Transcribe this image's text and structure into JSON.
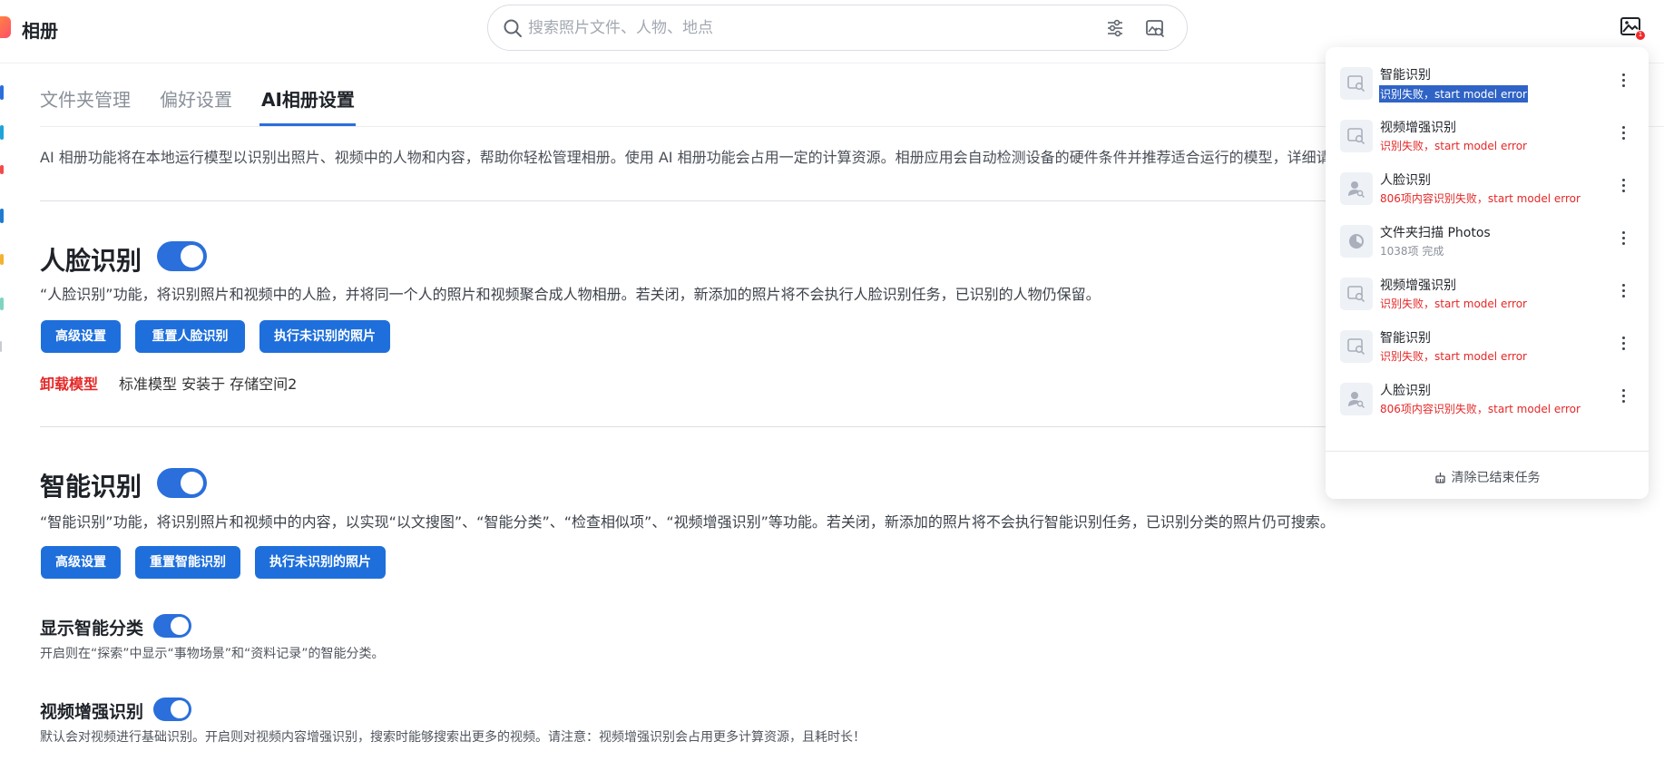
{
  "app": {
    "title": "相册",
    "logo_icon": "photos-app-icon"
  },
  "search": {
    "placeholder": "搜索照片文件、人物、地点",
    "value": "",
    "icons": [
      "search-icon",
      "filter-sliders-icon",
      "image-search-icon"
    ]
  },
  "header": {
    "task_badge": "1",
    "task_icon": "task-image-icon"
  },
  "tabs": [
    {
      "label": "文件夹管理",
      "active": false
    },
    {
      "label": "偏好设置",
      "active": false
    },
    {
      "label": "AI相册设置",
      "active": true
    }
  ],
  "intro": "AI 相册功能将在本地运行模型以识别出照片、视频中的人物和内容，帮助你轻松管理相册。使用 AI 相册功能会占用一定的计算资源。相册应用会自动检测设备的硬件条件并推荐适合运行的模型，详细请",
  "face": {
    "title": "人脸识别",
    "enabled": true,
    "desc": "“人脸识别”功能，将识别照片和视频中的人脸，并将同一个人的照片和视频聚合成人物相册。若关闭，新添加的照片将不会执行人脸识别任务，已识别的人物仍保留。",
    "buttons": {
      "advanced": "高级设置",
      "reset": "重置人脸识别",
      "run": "执行未识别的照片"
    },
    "uninstall": "卸载模型",
    "model_info": "标准模型 安装于 存储空间2"
  },
  "smart": {
    "title": "智能识别",
    "enabled": true,
    "desc": "“智能识别”功能，将识别照片和视频中的内容，以实现“以文搜图”、“智能分类”、“检查相似项”、“视频增强识别”等功能。若关闭，新添加的照片将不会执行智能识别任务，已识别分类的照片仍可搜索。",
    "buttons": {
      "advanced": "高级设置",
      "reset": "重置智能识别",
      "run": "执行未识别的照片"
    }
  },
  "show_category": {
    "title": "显示智能分类",
    "enabled": true,
    "desc": "开启则在“探索”中显示“事物场景”和“资料记录”的智能分类。"
  },
  "video_enhance": {
    "title": "视频增强识别",
    "enabled": true,
    "desc": "默认会对视频进行基础识别。开启则对视频内容增强识别，搜索时能够搜索出更多的视频。请注意：视频增强识别会占用更多计算资源，且耗时长！"
  },
  "tasks": {
    "items": [
      {
        "name": "智能识别",
        "status": "识别失败，start model error",
        "state": "error-selected",
        "icon": "image-search-icon"
      },
      {
        "name": "视频增强识别",
        "status": "识别失败，start model error",
        "state": "error",
        "icon": "image-search-icon"
      },
      {
        "name": "人脸识别",
        "status": "806项内容识别失败，start model error",
        "state": "error",
        "icon": "person-search-icon"
      },
      {
        "name": "文件夹扫描 Photos",
        "status": "1038项 完成",
        "state": "done",
        "icon": "pie-progress-icon"
      },
      {
        "name": "视频增强识别",
        "status": "识别失败，start model error",
        "state": "error",
        "icon": "image-search-icon"
      },
      {
        "name": "智能识别",
        "status": "识别失败，start model error",
        "state": "error",
        "icon": "image-search-icon"
      },
      {
        "name": "人脸识别",
        "status": "806项内容识别失败，start model error",
        "state": "error",
        "icon": "person-search-icon"
      }
    ],
    "clear_label": "清除已结束任务"
  },
  "colors": {
    "accent": "#1e6fdb",
    "error": "#e52727",
    "selection": "#2f63c6"
  }
}
